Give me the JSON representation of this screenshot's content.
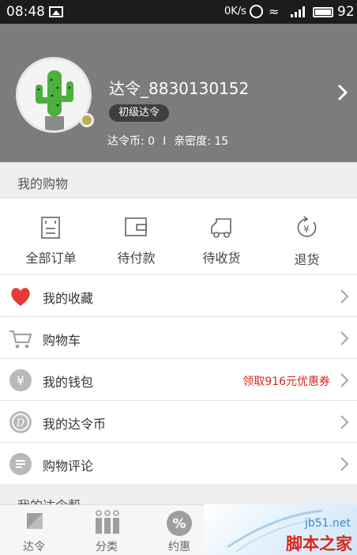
{
  "status_bar": {
    "time": "08:48",
    "network_speed": "0K/s",
    "battery": "92"
  },
  "profile": {
    "username": "达令_8830130152",
    "level": "初级达令",
    "coins_label": "达令币: 0",
    "separator": "I",
    "intimacy_label": "亲密度: 15"
  },
  "my_shopping": {
    "title": "我的购物",
    "orders": [
      {
        "label": "全部订单",
        "icon": "order-list-icon"
      },
      {
        "label": "待付款",
        "icon": "wallet-icon"
      },
      {
        "label": "待收货",
        "icon": "delivery-truck-icon"
      },
      {
        "label": "退货",
        "icon": "return-yen-icon"
      }
    ],
    "rows": [
      {
        "label": "我的收藏",
        "icon": "heart-icon",
        "extra": ""
      },
      {
        "label": "购物车",
        "icon": "cart-icon",
        "extra": ""
      },
      {
        "label": "我的钱包",
        "icon": "yen-coin-icon",
        "extra": "领取916元优惠券"
      },
      {
        "label": "我的达令币",
        "icon": "d-coin-icon",
        "extra": ""
      },
      {
        "label": "购物评论",
        "icon": "comment-icon",
        "extra": ""
      }
    ]
  },
  "section_partial": "我的达令帮",
  "tabbar": {
    "tabs": [
      {
        "label": "达令",
        "icon": "darling-logo-icon"
      },
      {
        "label": "分类",
        "icon": "category-grid-icon"
      },
      {
        "label": "约惠",
        "icon": "percent-discount-icon"
      }
    ]
  },
  "watermark": {
    "site": "jb51.net",
    "brand": "脚本之家"
  },
  "colors": {
    "header_bg": "#7c7c7c",
    "accent_red": "#d9261c",
    "cactus_green": "#4caf3e"
  }
}
